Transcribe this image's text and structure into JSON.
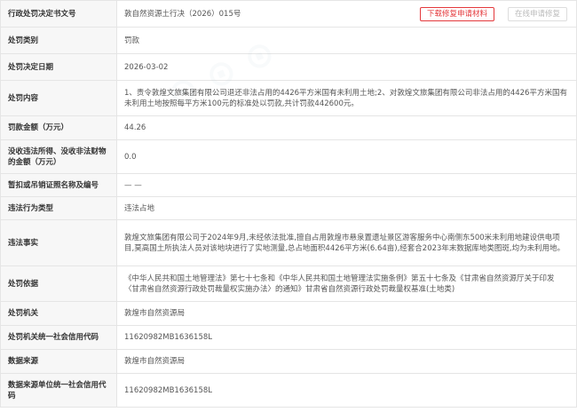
{
  "rows": [
    {
      "label": "行政处罚决定书文号",
      "value": "敦自然资源土行决（2026）015号"
    },
    {
      "label": "处罚类别",
      "value": "罚款"
    },
    {
      "label": "处罚决定日期",
      "value": "2026-03-02"
    },
    {
      "label": "处罚内容",
      "value": "1、责令敦煌文旅集团有限公司退还非法占用的4426平方米国有未利用土地;2、对敦煌文旅集团有限公司非法占用的4426平方米国有未利用土地按照每平方米100元的标准处以罚款,共计罚款442600元。"
    },
    {
      "label": "罚款金额（万元）",
      "value": "44.26"
    },
    {
      "label": "没收违法所得、没收非法财物的金额（万元）",
      "value": "0.0"
    },
    {
      "label": "暂扣或吊销证照名称及编号",
      "value": "— —"
    },
    {
      "label": "违法行为类型",
      "value": "违法占地"
    },
    {
      "label": "违法事实",
      "value": "敦煌文旅集团有限公司于2024年9月,未经依法批准,擅自占用敦煌市悬泉置遗址景区游客服务中心南侧东500米未利用地建设供电项目,莫高国土所执法人员对该地块进行了实地测量,总占地面积4426平方米(6.64亩),经套合2023年末数据库地类图斑,均为未利用地。"
    },
    {
      "label": "处罚依据",
      "value": "《中华人民共和国土地管理法》第七十七条和《中华人民共和国土地管理法实施条例》第五十七条及《甘肃省自然资源厅关于印发〈甘肃省自然资源行政处罚裁量权实施办法〉的通知》甘肃省自然资源行政处罚裁量权基准(土地类)"
    },
    {
      "label": "处罚机关",
      "value": "敦煌市自然资源局"
    },
    {
      "label": "处罚机关统一社会信用代码",
      "value": "11620982MB1636158L"
    },
    {
      "label": "数据来源",
      "value": "敦煌市自然资源局"
    },
    {
      "label": "数据来源单位统一社会信用代码",
      "value": "11620982MB1636158L"
    }
  ],
  "buttons": {
    "download": "下载修复申请材料",
    "online": "在线申请修复"
  },
  "colors": {
    "label_bg": "#f7f7f7",
    "border": "#e5e5e5",
    "accent_red": "#e4393c"
  }
}
